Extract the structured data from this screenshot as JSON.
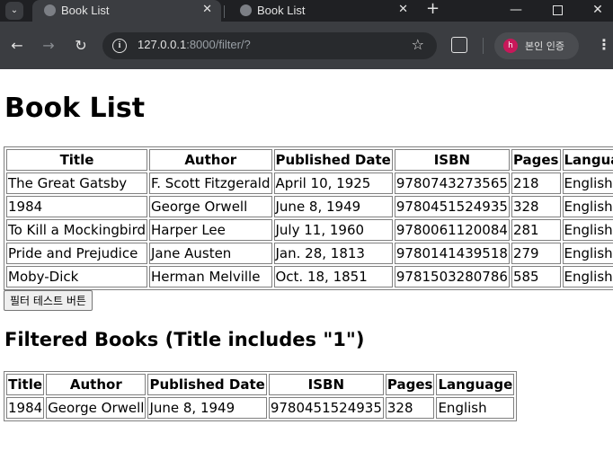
{
  "browser": {
    "tabs": [
      {
        "title": "Book List",
        "active": true
      },
      {
        "title": "Book List",
        "active": false
      }
    ],
    "url_host": "127.0.0.1",
    "url_path": ":8000/filter/?",
    "profile_initial": "h",
    "profile_label": "본인 인증"
  },
  "page": {
    "title": "Book List",
    "columns": [
      "Title",
      "Author",
      "Published Date",
      "ISBN",
      "Pages",
      "Language"
    ],
    "books": [
      [
        "The Great Gatsby",
        "F. Scott Fitzgerald",
        "April 10, 1925",
        "9780743273565",
        "218",
        "English"
      ],
      [
        "1984",
        "George Orwell",
        "June 8, 1949",
        "9780451524935",
        "328",
        "English"
      ],
      [
        "To Kill a Mockingbird",
        "Harper Lee",
        "July 11, 1960",
        "9780061120084",
        "281",
        "English"
      ],
      [
        "Pride and Prejudice",
        "Jane Austen",
        "Jan. 28, 1813",
        "9780141439518",
        "279",
        "English"
      ],
      [
        "Moby-Dick",
        "Herman Melville",
        "Oct. 18, 1851",
        "9781503280786",
        "585",
        "English"
      ]
    ],
    "button_label": "필터 테스트 버튼",
    "filtered_title": "Filtered Books (Title includes \"1\")",
    "filtered_books": [
      [
        "1984",
        "George Orwell",
        "June 8, 1949",
        "9780451524935",
        "328",
        "English"
      ]
    ]
  }
}
